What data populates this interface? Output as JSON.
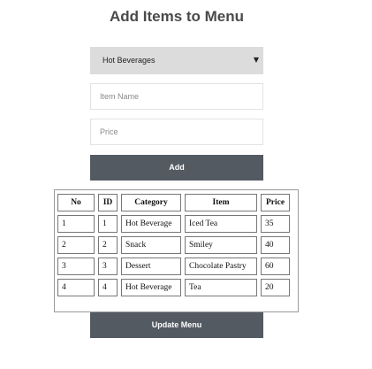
{
  "page": {
    "title": "Add Items to Menu"
  },
  "form": {
    "category_select": {
      "selected": "Hot Beverages",
      "caret": "▼"
    },
    "item_name": {
      "value": "",
      "placeholder": "Item Name"
    },
    "price": {
      "value": "",
      "placeholder": "Price"
    },
    "add_label": "Add"
  },
  "table": {
    "headers": [
      "No",
      "ID",
      "Category",
      "Item",
      "Price"
    ],
    "rows": [
      [
        "1",
        "1",
        "Hot Beverage",
        "Iced Tea",
        "35"
      ],
      [
        "2",
        "2",
        "Snack",
        "Smiley",
        "40"
      ],
      [
        "3",
        "3",
        "Dessert",
        "Chocolate Pastry",
        "60"
      ],
      [
        "4",
        "4",
        "Hot Beverage",
        "Tea",
        "20"
      ]
    ]
  },
  "update_label": "Update Menu",
  "colors": {
    "button_bg": "#535a62",
    "select_bg": "#dcdcdc",
    "title_text": "#4a4a4a"
  }
}
